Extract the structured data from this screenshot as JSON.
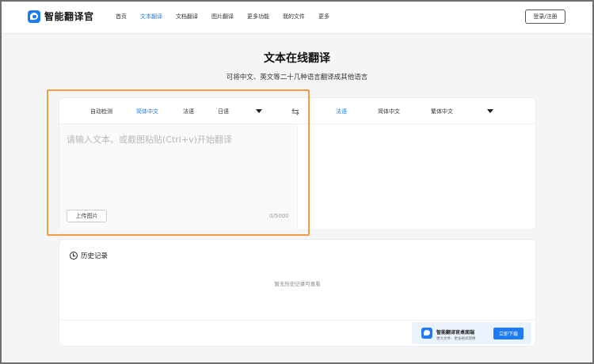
{
  "app": {
    "name": "智能翻译官"
  },
  "nav": [
    "首页",
    "文本翻译",
    "文档翻译",
    "图片翻译",
    "更多功能",
    "我的文件",
    "更多"
  ],
  "nav_active_index": 1,
  "header": {
    "login_label": "登录/注册"
  },
  "hero": {
    "title": "文本在线翻译",
    "subtitle": "可将中文、英文等二十几种语言翻译成其他语言"
  },
  "source": {
    "languages": [
      "自动检测",
      "简体中文",
      "法语",
      "日语"
    ],
    "active_index": 1,
    "placeholder": "请输入文本、或截图粘贴(Ctrl+v)开始翻译",
    "upload_label": "上传图片",
    "counter": "0/5000"
  },
  "target": {
    "languages": [
      "法语",
      "简体中文",
      "繁体中文"
    ],
    "active_index": 0
  },
  "history": {
    "title": "历史记录",
    "empty_text": "暂无历史记录可查看"
  },
  "promo": {
    "title": "智能翻译官桌面端",
    "subtitle": "更大文件、更多格式转换",
    "button_label": "立即下载"
  },
  "colors": {
    "accent": "#1f7bf2",
    "highlight": "#f39a44"
  },
  "icons": {
    "logo": "chat-bubble-logo-icon",
    "swap": "swap-arrows-icon",
    "caret": "caret-down-icon",
    "history": "history-clock-icon"
  }
}
